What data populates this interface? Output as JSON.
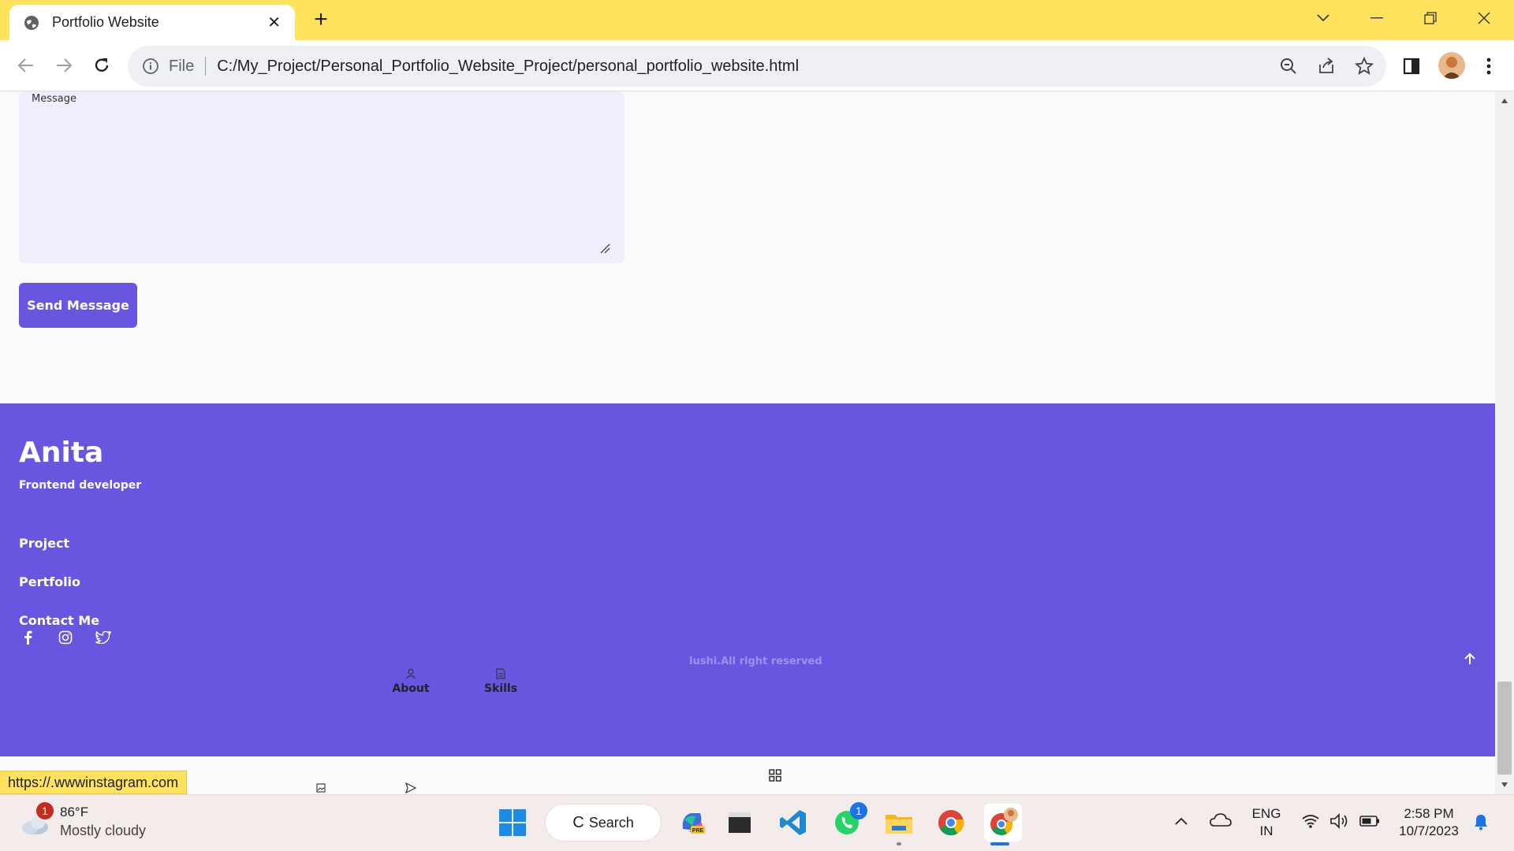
{
  "browser": {
    "tab_title": "Portfolio Website",
    "omnibox": {
      "scheme_label": "File",
      "url": "C:/My_Project/Personal_Portfolio_Website_Project/personal_portfolio_website.html"
    },
    "status_url": "https://.wwwinstagram.com"
  },
  "page": {
    "contact_form": {
      "message_label": "Message",
      "send_button_label": "Send Message"
    },
    "footer": {
      "name": "Anita",
      "role": "Frontend developer",
      "links": [
        "Project",
        "Pertfolio",
        "Contact Me"
      ],
      "socials": [
        "facebook-icon",
        "instagram-icon",
        "twitter-icon"
      ],
      "copyright": "lushi.All right reserved"
    },
    "bottom_nav": {
      "about_label": "About",
      "skills_label": "Skills"
    }
  },
  "taskbar": {
    "weather": {
      "temp": "86°F",
      "desc": "Mostly cloudy",
      "badge": "1"
    },
    "search_label": "Search",
    "whatsapp_badge": "1",
    "language": {
      "line1": "ENG",
      "line2": "IN"
    },
    "clock": {
      "time": "2:58 PM",
      "date": "10/7/2023"
    }
  },
  "colors": {
    "tab_strip": "#ffe25d",
    "accent": "#6956e0",
    "message_bg": "#efeefa"
  }
}
